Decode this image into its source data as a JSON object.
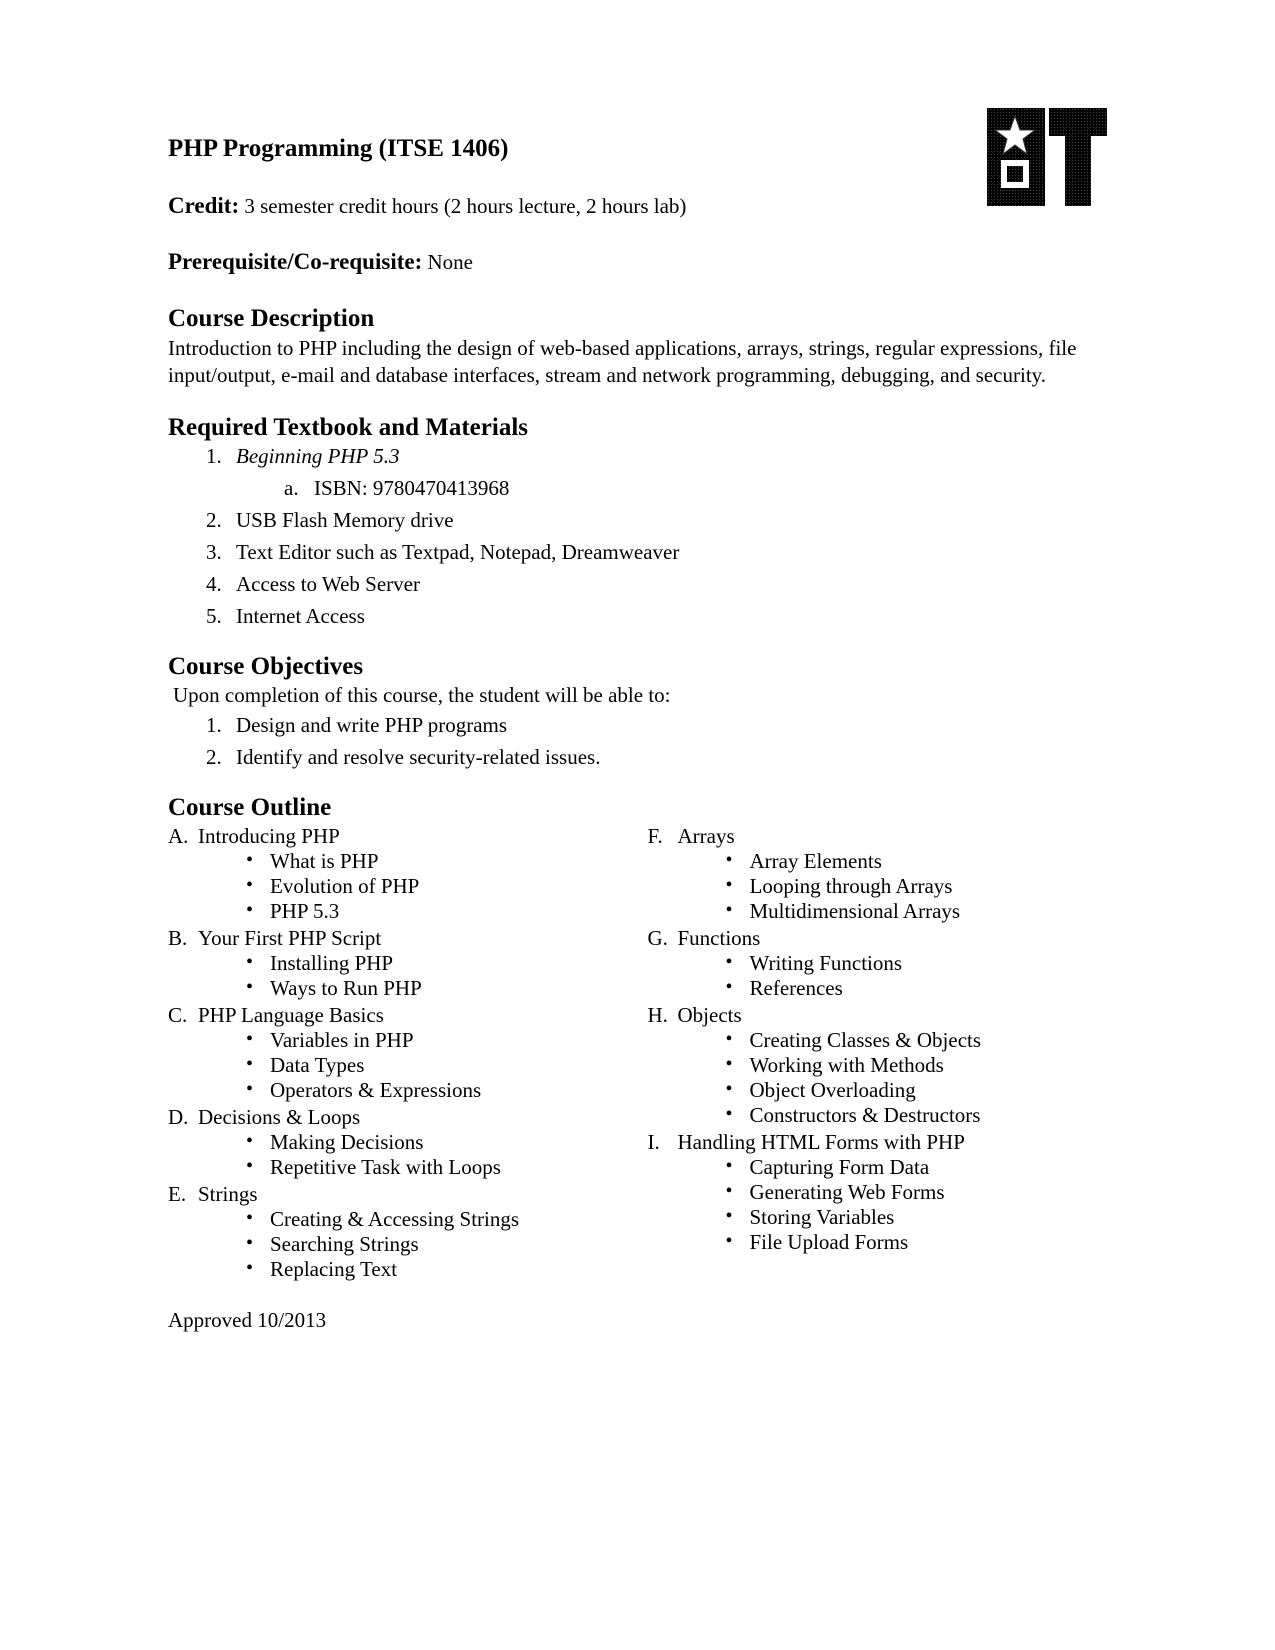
{
  "title": "PHP Programming (ITSE 1406)",
  "credit": {
    "label": "Credit:",
    "value": "3 semester credit hours (2 hours lecture, 2 hours lab)"
  },
  "prerequisite": {
    "label": "Prerequisite/Co-requisite:",
    "value": "None"
  },
  "course_description": {
    "heading": "Course Description",
    "text": "Introduction to PHP including the design of web-based applications, arrays, strings, regular expressions, file input/output, e-mail and database interfaces, stream and network programming, debugging, and security."
  },
  "materials": {
    "heading": "Required Textbook and Materials",
    "items": [
      {
        "num": "1.",
        "text": "Beginning PHP 5.3",
        "italic": true,
        "sub": [
          {
            "letter": "a.",
            "text": "ISBN: 9780470413968"
          }
        ]
      },
      {
        "num": "2.",
        "text": "USB Flash Memory drive"
      },
      {
        "num": "3.",
        "text": "Text Editor such as Textpad, Notepad, Dreamweaver"
      },
      {
        "num": "4.",
        "text": "Access to Web Server"
      },
      {
        "num": "5.",
        "text": "Internet Access"
      }
    ]
  },
  "objectives": {
    "heading": "Course Objectives",
    "intro": "Upon completion of this course, the student will be able to:",
    "items": [
      {
        "num": "1.",
        "text": "Design and write PHP programs"
      },
      {
        "num": "2.",
        "text": "Identify and resolve security-related issues."
      }
    ]
  },
  "outline": {
    "heading": "Course Outline",
    "left": [
      {
        "letter": "A.",
        "title": "Introducing PHP",
        "bullets": [
          "What is PHP",
          "Evolution of PHP",
          "PHP 5.3"
        ]
      },
      {
        "letter": "B.",
        "title": "Your First PHP Script",
        "bullets": [
          "Installing PHP",
          "Ways to Run PHP"
        ]
      },
      {
        "letter": "C.",
        "title": "PHP Language Basics",
        "bullets": [
          "Variables in PHP",
          "Data Types",
          "Operators & Expressions"
        ]
      },
      {
        "letter": "D.",
        "title": "Decisions & Loops",
        "bullets": [
          "Making Decisions",
          "Repetitive Task with Loops"
        ]
      },
      {
        "letter": "E.",
        "title": "Strings",
        "bullets": [
          "Creating & Accessing Strings",
          "Searching Strings",
          "Replacing Text"
        ]
      }
    ],
    "right": [
      {
        "letter": "F.",
        "title": "Arrays",
        "bullets": [
          "Array Elements",
          "Looping through Arrays",
          "Multidimensional Arrays"
        ]
      },
      {
        "letter": "G.",
        "title": "Functions",
        "bullets": [
          "Writing Functions",
          "References"
        ]
      },
      {
        "letter": "H.",
        "title": "Objects",
        "bullets": [
          "Creating Classes & Objects",
          "Working with Methods",
          "Object Overloading",
          "Constructors & Destructors"
        ]
      },
      {
        "letter": "I.",
        "title": "Handling HTML Forms with PHP",
        "bullets": [
          "Capturing Form Data",
          "Generating Web Forms",
          "Storing Variables",
          "File Upload Forms"
        ]
      }
    ]
  },
  "footer": "Approved 10/2013"
}
